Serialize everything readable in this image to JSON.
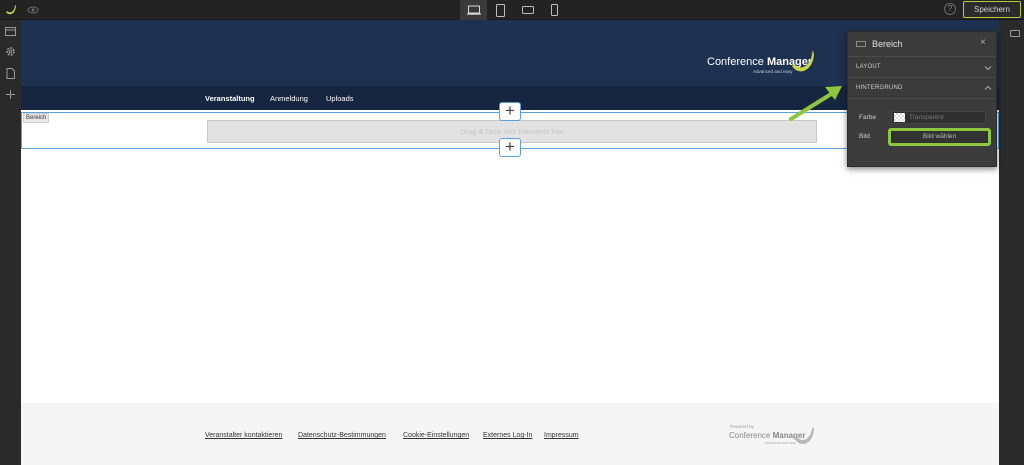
{
  "toolbar": {
    "save_label": "Speichern",
    "help_label": "?"
  },
  "icons": {
    "logo": "banana-logo-icon",
    "preview": "eye-icon",
    "devices": [
      "desktop-icon",
      "tablet-portrait-icon",
      "tablet-landscape-icon",
      "phone-icon"
    ],
    "left_sidebar": [
      "pages-icon",
      "settings-gear-icon",
      "document-icon",
      "add-icon"
    ]
  },
  "site": {
    "brand_light": "Conference ",
    "brand_bold": "Manager",
    "tagline": "Advanced and easy",
    "nav": [
      "Veranstaltung",
      "Anmeldung",
      "Uploads"
    ]
  },
  "section": {
    "tag": "Bereich",
    "dropzone": "Drag & Drop des Elements hier",
    "plus": "+"
  },
  "footer": {
    "links": [
      "Veranstalter kontaktieren",
      "Datenschutz-Bestimmungen",
      "Cookie-Einstellungen",
      "Externes Log-In",
      "Impressum"
    ],
    "powered_by": "Powered by",
    "brand_light": "Conference ",
    "brand_bold": "Manager",
    "tagline": "Advanced and easy"
  },
  "panel": {
    "title": "Bereich",
    "close": "×",
    "layout_label": "LAYOUT",
    "background_label": "HINTERGRUND",
    "color_label": "Farbe",
    "color_value": "Transparent",
    "image_label": "Bild",
    "image_button": "Bild wählen"
  },
  "colors": {
    "header_bg": "#1e3150",
    "accent_green": "#8ec63f",
    "selection_blue": "#5aa0dc"
  }
}
